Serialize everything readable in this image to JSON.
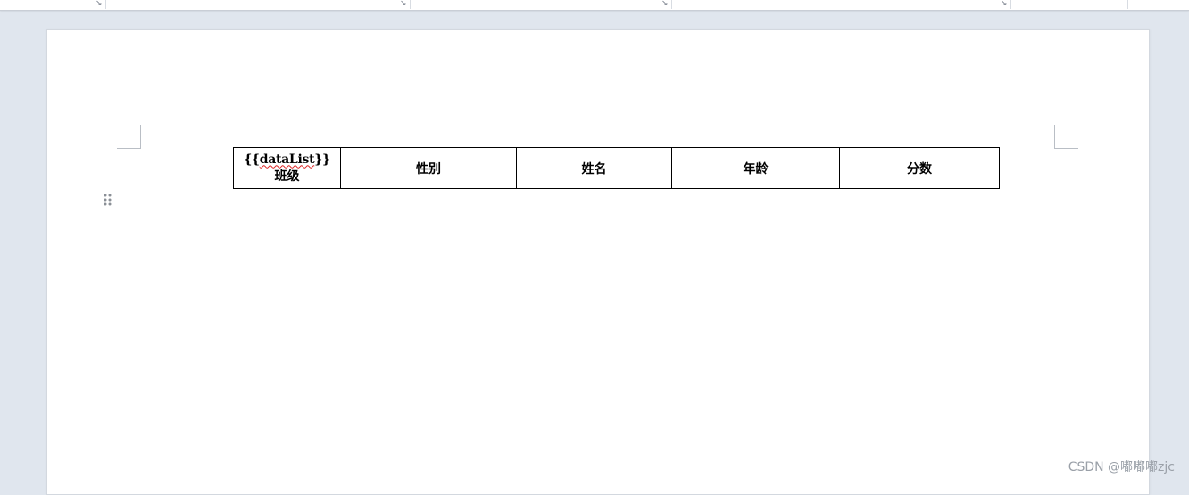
{
  "document": {
    "table": {
      "first_cell": {
        "tag_open": "{{",
        "tag_name": "dataList",
        "tag_close": "}}",
        "label": "班级"
      },
      "headers": [
        "性别",
        "姓名",
        "年龄",
        "分数"
      ]
    }
  },
  "watermark": {
    "text": "CSDN @嘟嘟嘟zjc"
  },
  "icons": {
    "table_move_handle": "drag-handle-icon",
    "dialog_launcher": "dialog-launcher-icon"
  },
  "colors": {
    "app_background": "#e0e6ee",
    "page": "#ffffff",
    "table_border": "#000000",
    "spellcheck_underline": "#dd2222"
  }
}
